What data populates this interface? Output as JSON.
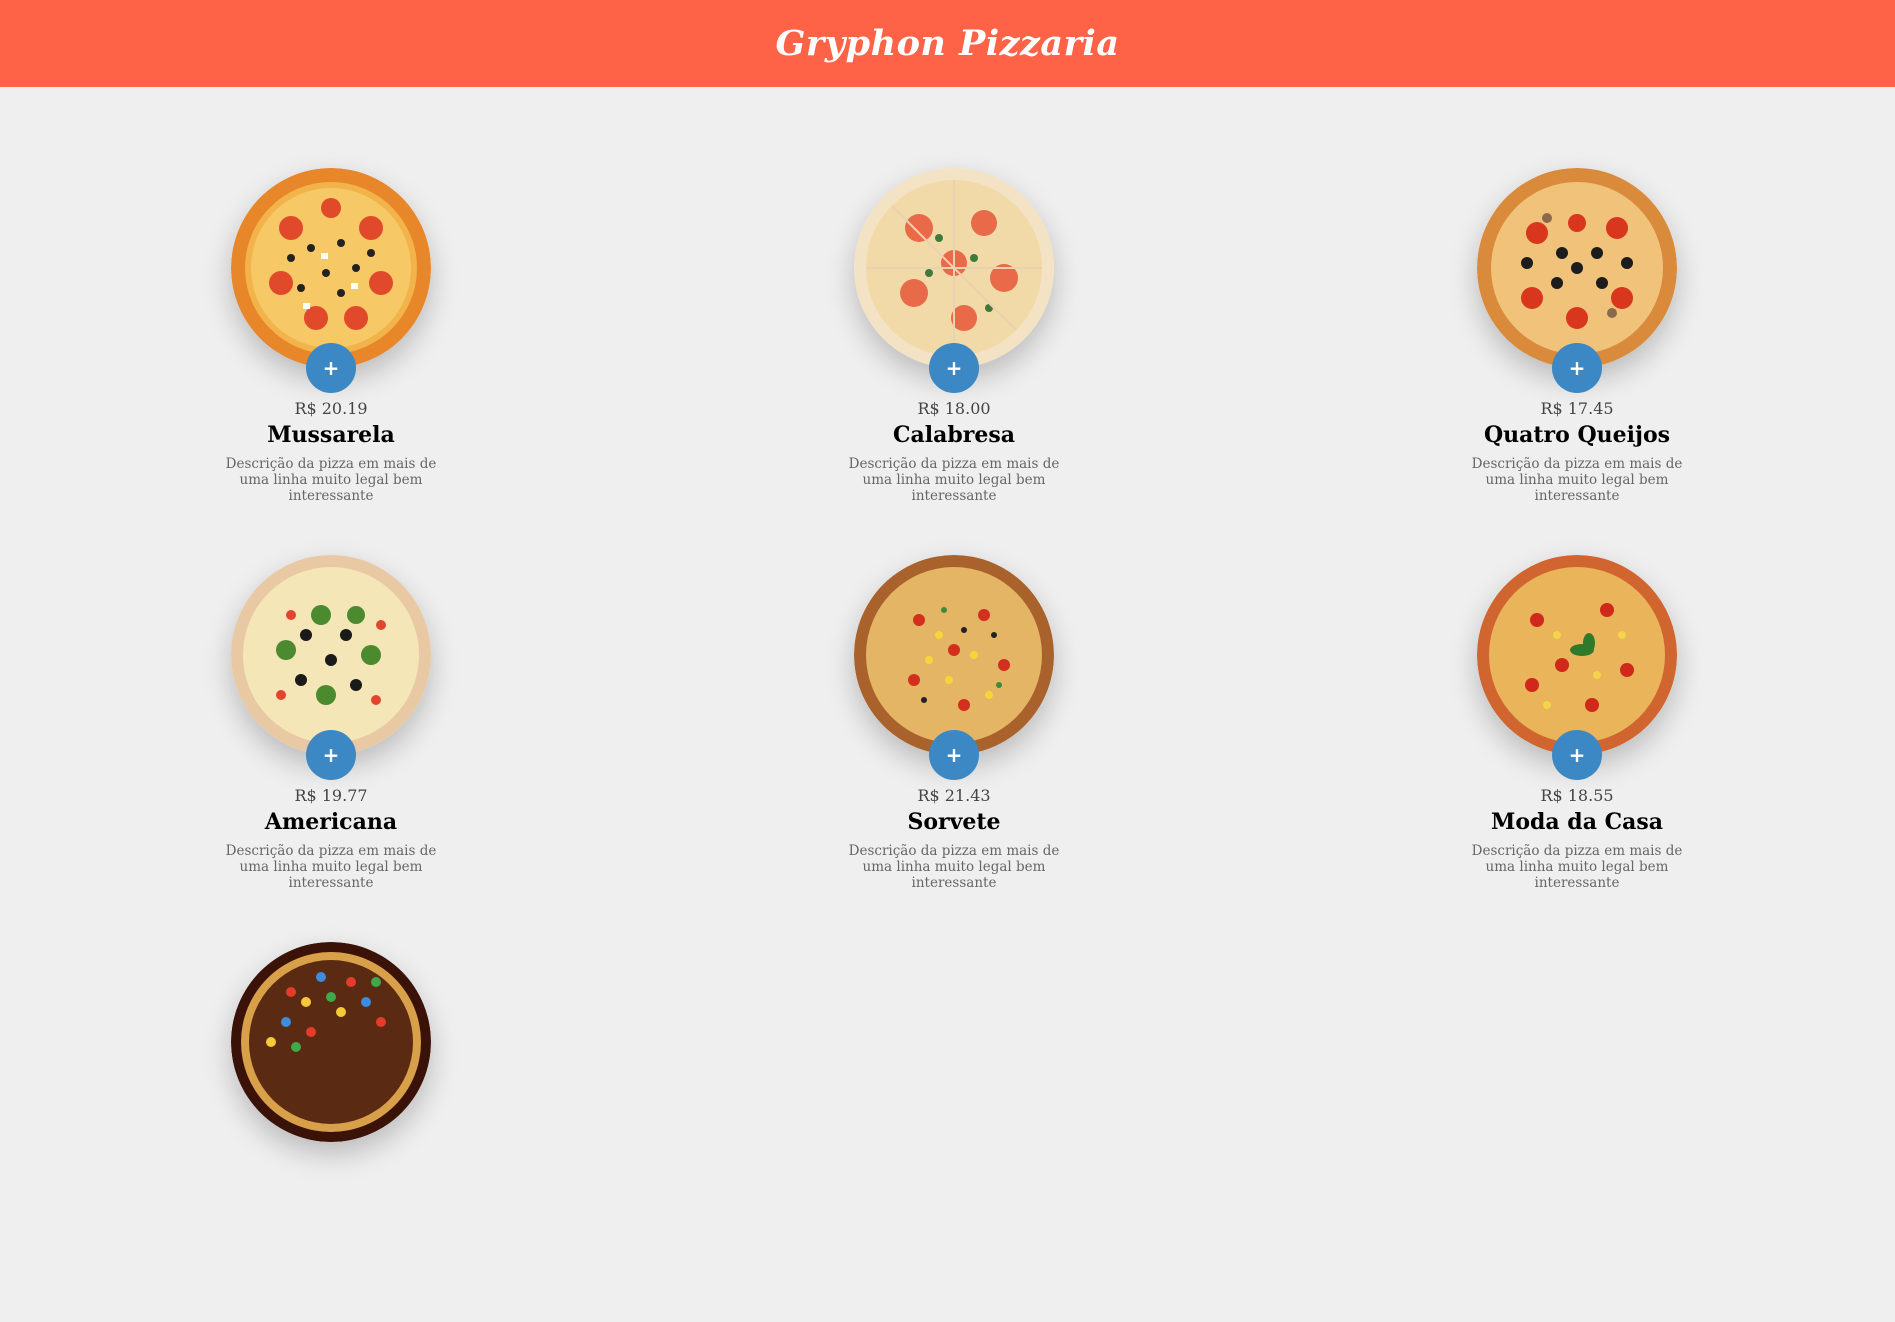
{
  "header": {
    "title": "Gryphon Pizzaria"
  },
  "colors": {
    "header_bg": "#ff6347",
    "button": "#3b88c4",
    "page_bg": "#efefef"
  },
  "add_icon": "plus-icon",
  "add_label": "+",
  "pizzas": [
    {
      "price": "R$ 20.19",
      "name": "Mussarela",
      "description": "Descrição da pizza em mais de uma linha muito legal bem interessante"
    },
    {
      "price": "R$ 18.00",
      "name": "Calabresa",
      "description": "Descrição da pizza em mais de uma linha muito legal bem interessante"
    },
    {
      "price": "R$ 17.45",
      "name": "Quatro Queijos",
      "description": "Descrição da pizza em mais de uma linha muito legal bem interessante"
    },
    {
      "price": "R$ 19.77",
      "name": "Americana",
      "description": "Descrição da pizza em mais de uma linha muito legal bem interessante"
    },
    {
      "price": "R$ 21.43",
      "name": "Sorvete",
      "description": "Descrição da pizza em mais de uma linha muito legal bem interessante"
    },
    {
      "price": "R$ 18.55",
      "name": "Moda da Casa",
      "description": "Descrição da pizza em mais de uma linha muito legal bem interessante"
    },
    {
      "price": "",
      "name": "",
      "description": ""
    }
  ]
}
